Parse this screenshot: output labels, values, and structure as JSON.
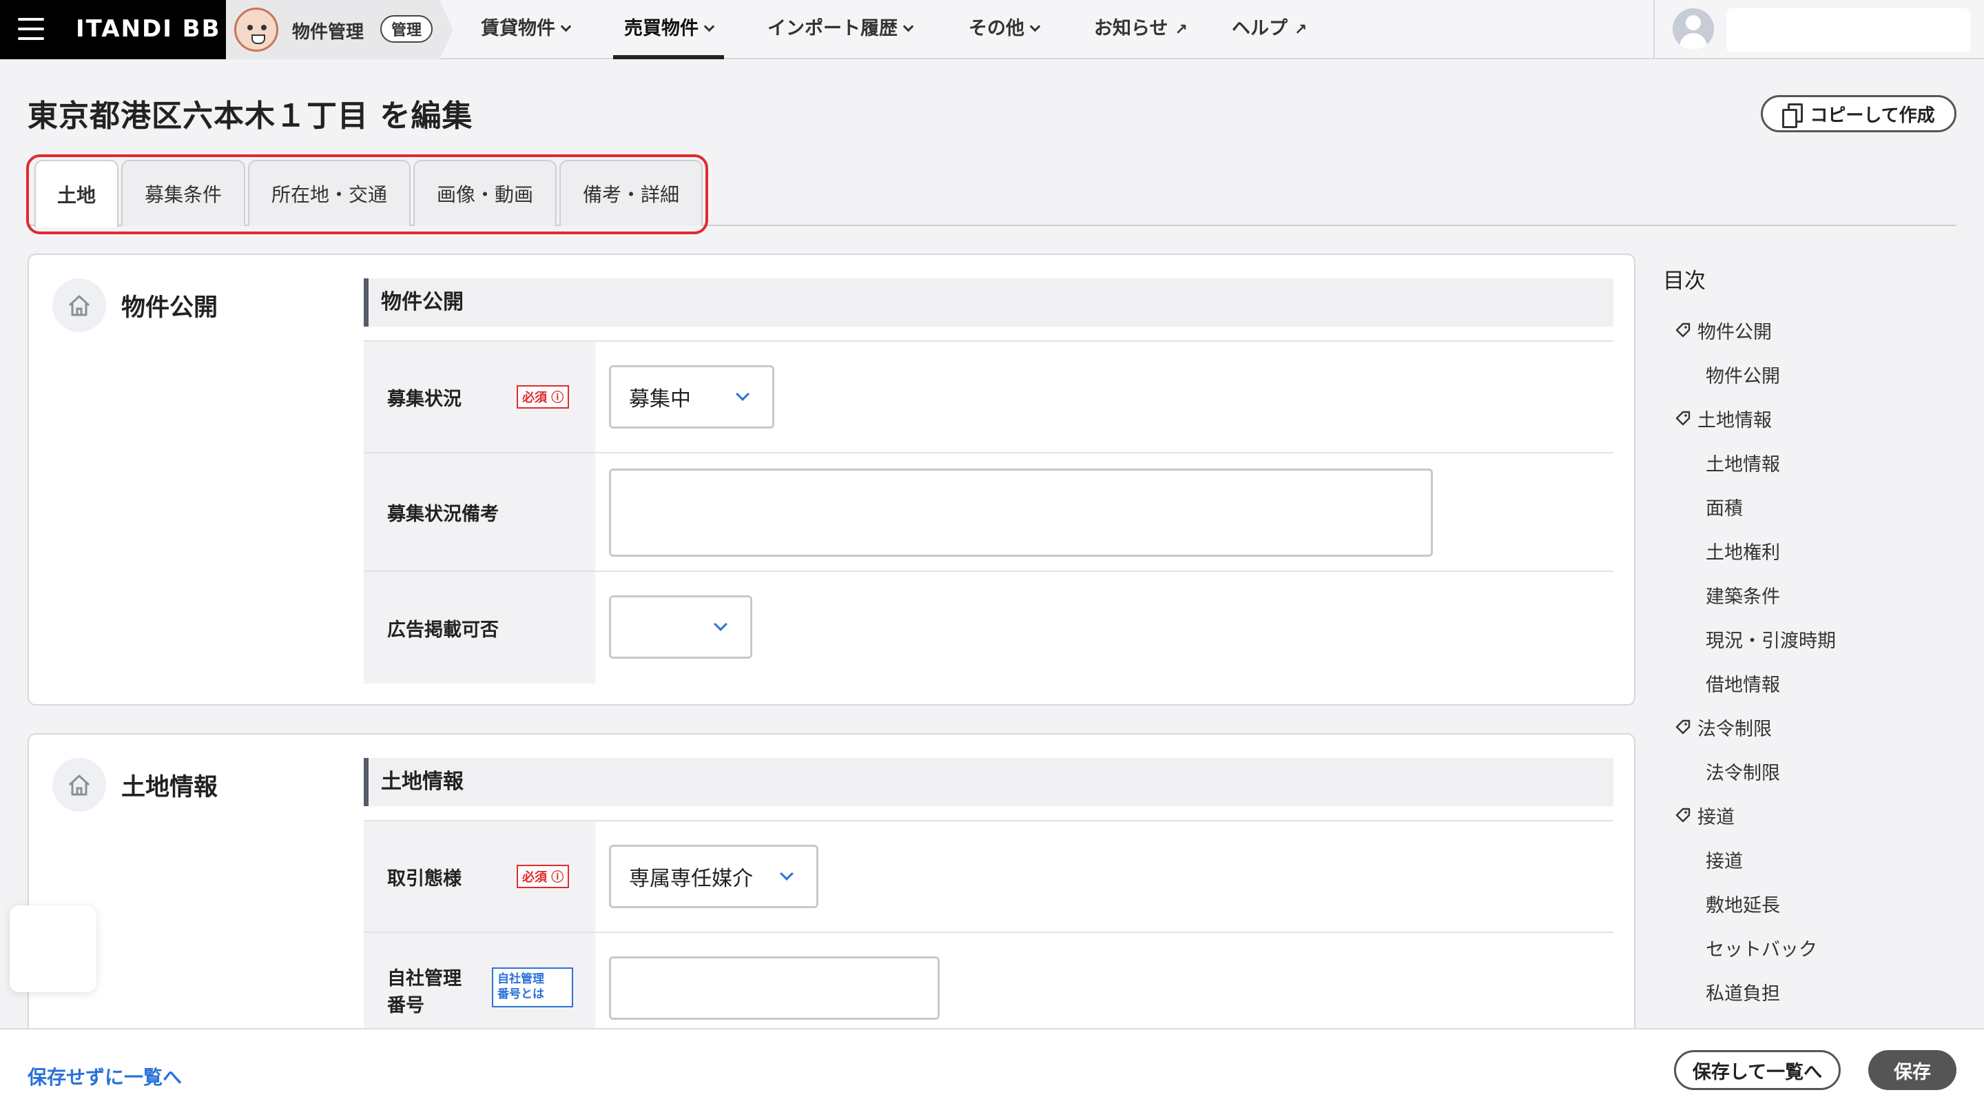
{
  "header": {
    "brand": "ITANDI BB",
    "app_name": "物件管理",
    "app_badge": "管理",
    "nav": [
      {
        "label": "賃貸物件"
      },
      {
        "label": "売買物件"
      },
      {
        "label": "インポート履歴"
      },
      {
        "label": "その他"
      },
      {
        "label": "お知らせ"
      },
      {
        "label": "ヘルプ"
      }
    ]
  },
  "page": {
    "title": "東京都港区六本木１丁目 を編集",
    "copy_button": "コピーして作成"
  },
  "tabs": [
    {
      "label": "土地"
    },
    {
      "label": "募集条件"
    },
    {
      "label": "所在地・交通"
    },
    {
      "label": "画像・動画"
    },
    {
      "label": "備考・詳細"
    }
  ],
  "cards": {
    "publish": {
      "title": "物件公開",
      "section": "物件公開",
      "rows": {
        "status": {
          "label": "募集状況",
          "badge": "必須",
          "value": "募集中"
        },
        "status_note": {
          "label": "募集状況備考",
          "value": ""
        },
        "ad": {
          "label": "広告掲載可否",
          "value": ""
        }
      }
    },
    "land": {
      "title": "土地情報",
      "section": "土地情報",
      "rows": {
        "deal": {
          "label": "取引態様",
          "badge": "必須",
          "value": "専属専任媒介"
        },
        "mgmt": {
          "label_line1": "自社管理",
          "label_line2": "番号",
          "badge_line1": "自社管理",
          "badge_line2": "番号とは",
          "value": ""
        }
      }
    }
  },
  "toc": {
    "heading": "目次",
    "items": [
      {
        "label": "物件公開"
      },
      {
        "label": "物件公開"
      },
      {
        "label": "土地情報"
      },
      {
        "label": "土地情報"
      },
      {
        "label": "面積"
      },
      {
        "label": "土地権利"
      },
      {
        "label": "建築条件"
      },
      {
        "label": "現況・引渡時期"
      },
      {
        "label": "借地情報"
      },
      {
        "label": "法令制限"
      },
      {
        "label": "法令制限"
      },
      {
        "label": "接道"
      },
      {
        "label": "接道"
      },
      {
        "label": "敷地延長"
      },
      {
        "label": "セットバック"
      },
      {
        "label": "私道負担"
      }
    ]
  },
  "footer": {
    "back_link": "保存せずに一覧へ",
    "save_and_list": "保存して一覧へ",
    "save": "保存"
  }
}
